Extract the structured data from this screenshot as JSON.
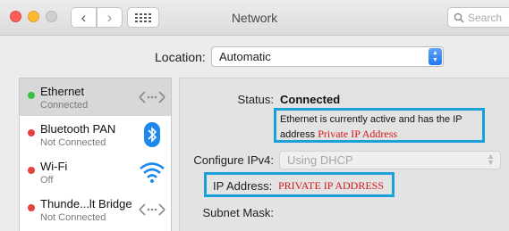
{
  "window": {
    "title": "Network",
    "search_placeholder": "Search",
    "back_glyph": "‹",
    "forward_glyph": "›"
  },
  "location": {
    "label": "Location:",
    "value": "Automatic"
  },
  "services": [
    {
      "name": "Ethernet",
      "status": "Connected",
      "status_color": "#34c240",
      "icon": "ethernet-arrows-icon",
      "selected": true
    },
    {
      "name": "Bluetooth PAN",
      "status": "Not Connected",
      "status_color": "#e5413b",
      "icon": "bluetooth-icon",
      "selected": false
    },
    {
      "name": "Wi-Fi",
      "status": "Off",
      "status_color": "#e5413b",
      "icon": "wifi-icon",
      "selected": false
    },
    {
      "name": "Thunde...lt Bridge",
      "status": "Not Connected",
      "status_color": "#e5413b",
      "icon": "thunderbolt-arrows-icon",
      "selected": false
    }
  ],
  "detail": {
    "status_label": "Status:",
    "status_value": "Connected",
    "status_desc_line1": "Ethernet is currently active and has the IP",
    "status_desc_line2": "address",
    "status_private_ip": "Private IP Address",
    "configure_label": "Configure IPv4:",
    "configure_value": "Using DHCP",
    "ip_label": "IP Address:",
    "ip_value": "PRIVATE IP ADDRESS",
    "subnet_label": "Subnet Mask:"
  },
  "colors": {
    "highlight_box": "#1aa1d9",
    "annotation_red": "#d51a1a",
    "accent_blue": "#2178f2"
  }
}
